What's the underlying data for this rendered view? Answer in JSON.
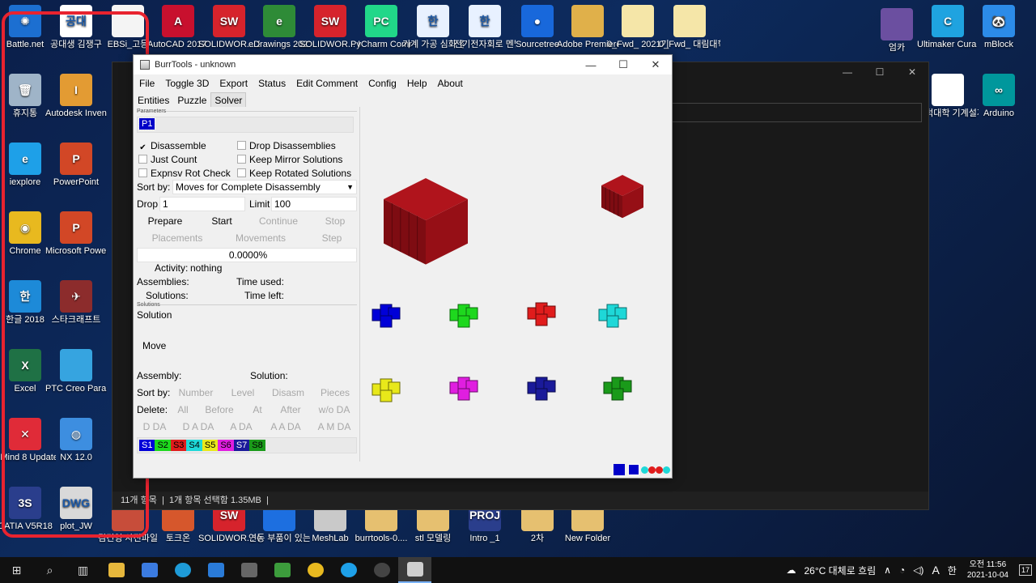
{
  "desktop": {
    "icons": [
      {
        "label": "Battle.net",
        "glyph": "✺",
        "color": "#1c6fd1"
      },
      {
        "label": "공대생 김쟁구",
        "glyph": "공대",
        "color": "#ffffff"
      },
      {
        "label": "EBSi_고등",
        "glyph": "",
        "color": "#f4f4f4"
      },
      {
        "label": "AutoCAD 2017 -",
        "glyph": "A",
        "color": "#c8102e"
      },
      {
        "label": "SOLIDWOR... 2021",
        "glyph": "SW",
        "color": "#d6232c"
      },
      {
        "label": "eDrawings 2021 x64",
        "glyph": "e",
        "color": "#2e8b37"
      },
      {
        "label": "SOLIDWOR... Inspection",
        "glyph": "SW",
        "color": "#d6232c"
      },
      {
        "label": "PyCharm Communi...",
        "glyph": "PC",
        "color": "#21d789"
      },
      {
        "label": "기계 가공 심화 경...",
        "glyph": "한",
        "color": "#e8f1ff"
      },
      {
        "label": "전기전자회로 멘탈부스...",
        "glyph": "한",
        "color": "#e8f1ff"
      },
      {
        "label": "Sourcetree",
        "glyph": "●",
        "color": "#1868db"
      },
      {
        "label": "Adobe Premiere Pro...",
        "glyph": "",
        "color": "#e0b04a"
      },
      {
        "label": "0_Fwd_ 2021기...",
        "glyph": "",
        "color": "#f5e6a8"
      },
      {
        "label": "0_Fwd_ 대림대학...",
        "glyph": "",
        "color": "#f5e6a8"
      },
      {
        "label": "엄카",
        "glyph": "",
        "color": "#6b4fa0"
      },
      {
        "label": "Ultimaker Cura 4.1.0",
        "glyph": "C",
        "color": "#1fa3e0"
      },
      {
        "label": "mBlock",
        "glyph": "🐼",
        "color": "#2c8be8"
      },
      {
        "label": "휴지통",
        "glyph": "🗑",
        "color": "#9fb4c8"
      },
      {
        "label": "Autodesk Inventor P...",
        "glyph": "I",
        "color": "#e39b33"
      },
      {
        "label": "대덕대학 기계설계과",
        "glyph": "",
        "color": "#ffffff"
      },
      {
        "label": "Arduino",
        "glyph": "∞",
        "color": "#00979c"
      },
      {
        "label": "iexplore",
        "glyph": "e",
        "color": "#1ea0e8"
      },
      {
        "label": "PowerPoint",
        "glyph": "P",
        "color": "#d24726"
      },
      {
        "label": "Chrome",
        "glyph": "◉",
        "color": "#e8b91f"
      },
      {
        "label": "Microsoft PowerPoi...",
        "glyph": "P",
        "color": "#d24726"
      },
      {
        "label": "한글 2018",
        "glyph": "한",
        "color": "#1d8ad8"
      },
      {
        "label": "스타크래프트",
        "glyph": "✈",
        "color": "#8c2c2c"
      },
      {
        "label": "Excel",
        "glyph": "X",
        "color": "#1f7145"
      },
      {
        "label": "PTC Creo Parametr...",
        "glyph": "",
        "color": "#36a4e0"
      },
      {
        "label": "XMind 8 Update 7",
        "glyph": "✕",
        "color": "#e02b38"
      },
      {
        "label": "NX 12.0",
        "glyph": "◍",
        "color": "#3d8ee0"
      },
      {
        "label": "CATIA V5R18",
        "glyph": "3S",
        "color": "#2a3e8c"
      },
      {
        "label": "plot_JW",
        "glyph": "DWG",
        "color": "#d9d9d9"
      },
      {
        "label": "김건영 사진파일",
        "glyph": "",
        "color": "#c74d3a"
      },
      {
        "label": "토크온",
        "glyph": "",
        "color": "#d6572c"
      },
      {
        "label": "SOLIDWOR... Composer ...",
        "glyph": "SW",
        "color": "#d6232c"
      },
      {
        "label": "연동 부품이 있는 3D 개...",
        "glyph": "",
        "color": "#1d6fe0"
      },
      {
        "label": "MeshLab",
        "glyph": "",
        "color": "#c9c9c9"
      },
      {
        "label": "burrtools-0....",
        "glyph": "",
        "color": "#e6c070"
      },
      {
        "label": "stl 모델링",
        "glyph": "",
        "color": "#e6c070"
      },
      {
        "label": "Intro _1",
        "glyph": "PROJ",
        "color": "#2a3e8c"
      },
      {
        "label": "2차",
        "glyph": "",
        "color": "#e6c070"
      },
      {
        "label": "New Folder",
        "glyph": "",
        "color": "#e6c070"
      }
    ]
  },
  "explorer": {
    "status_count": "11개 항목",
    "status_selected": "1개 항목 선택함 1.35MB"
  },
  "burrtools": {
    "title": "BurrTools - unknown",
    "menu": [
      "File",
      "Toggle 3D",
      "Export",
      "Status",
      "Edit Comment",
      "Config",
      "Help",
      "About"
    ],
    "tabs": [
      "Entities",
      "Puzzle",
      "Solver"
    ],
    "active_tab": "Solver",
    "parameters_label": "Parameters",
    "problem_item": "P1",
    "options": {
      "disassemble": "Disassemble",
      "drop_disassemblies": "Drop Disassemblies",
      "just_count": "Just Count",
      "keep_mirror": "Keep Mirror Solutions",
      "expnsv_rot": "Expnsv Rot Check",
      "keep_rotated": "Keep Rotated Solutions",
      "disassemble_checked": true
    },
    "sort_by_label": "Sort by:",
    "sort_by_value": "Moves for Complete Disassembly",
    "drop_label": "Drop",
    "drop_value": "1",
    "limit_label": "Limit",
    "limit_value": "100",
    "buttons_row1": [
      "Prepare",
      "Start",
      "Continue",
      "Stop"
    ],
    "buttons_row2": [
      "Placements",
      "Movements",
      "Step"
    ],
    "progress": "0.0000%",
    "activity_label": "Activity:",
    "activity_value": "nothing",
    "assemblies_label": "Assemblies:",
    "time_used_label": "Time used:",
    "solutions_label": "Solutions:",
    "time_left_label": "Time left:",
    "solutions_section": "Solutions",
    "solution_label": "Solution",
    "move_label": "Move",
    "assembly_label": "Assembly:",
    "solution2_label": "Solution:",
    "sort_by2_label": "Sort by:",
    "sort_buttons": [
      "Number",
      "Level",
      "Disasm",
      "Pieces"
    ],
    "delete_label": "Delete:",
    "delete_buttons": [
      "All",
      "Before",
      "At",
      "After",
      "w/o DA"
    ],
    "da_buttons": [
      "D DA",
      "D A DA",
      "A DA",
      "A A DA",
      "A M DA"
    ],
    "shapes": [
      {
        "label": "S1",
        "color": "#0000d8"
      },
      {
        "label": "S2",
        "color": "#1ed81e"
      },
      {
        "label": "S3",
        "color": "#e01c1c"
      },
      {
        "label": "S4",
        "color": "#1ed8d8"
      },
      {
        "label": "S5",
        "color": "#e8e81a"
      },
      {
        "label": "S6",
        "color": "#e01ee0"
      },
      {
        "label": "S7",
        "color": "#1a1a9a"
      },
      {
        "label": "S8",
        "color": "#1a9a1a"
      }
    ]
  },
  "taskbar": {
    "weather": "26°C 대체로 흐림",
    "ime_a": "A",
    "ime_han": "한",
    "time": "오전 11:56",
    "date": "2021-10-04",
    "notif_count": "17"
  }
}
